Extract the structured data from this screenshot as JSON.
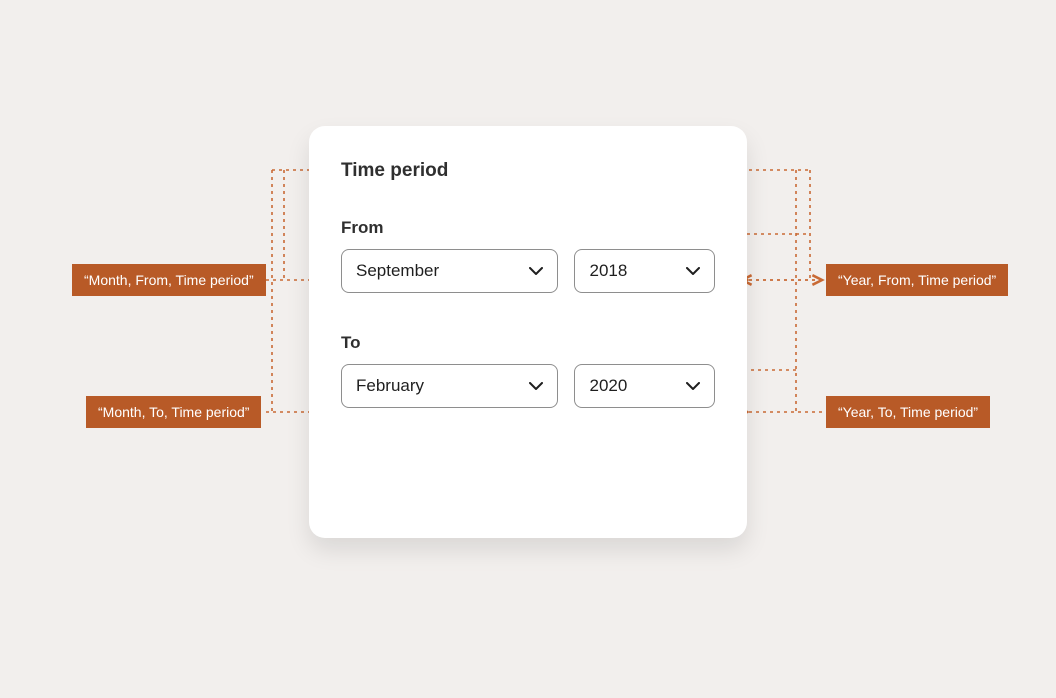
{
  "card": {
    "title": "Time period",
    "from": {
      "label": "From",
      "month": "September",
      "year": "2018"
    },
    "to": {
      "label": "To",
      "month": "February",
      "year": "2020"
    }
  },
  "annotations": {
    "month_from": "“Month, From, Time period”",
    "year_from": "“Year, From, Time period”",
    "month_to": "“Month, To, Time period”",
    "year_to": "“Year, To, Time period”"
  },
  "colors": {
    "annotation": "#b85a27",
    "card_bg": "#ffffff",
    "page_bg": "#f2efed"
  }
}
